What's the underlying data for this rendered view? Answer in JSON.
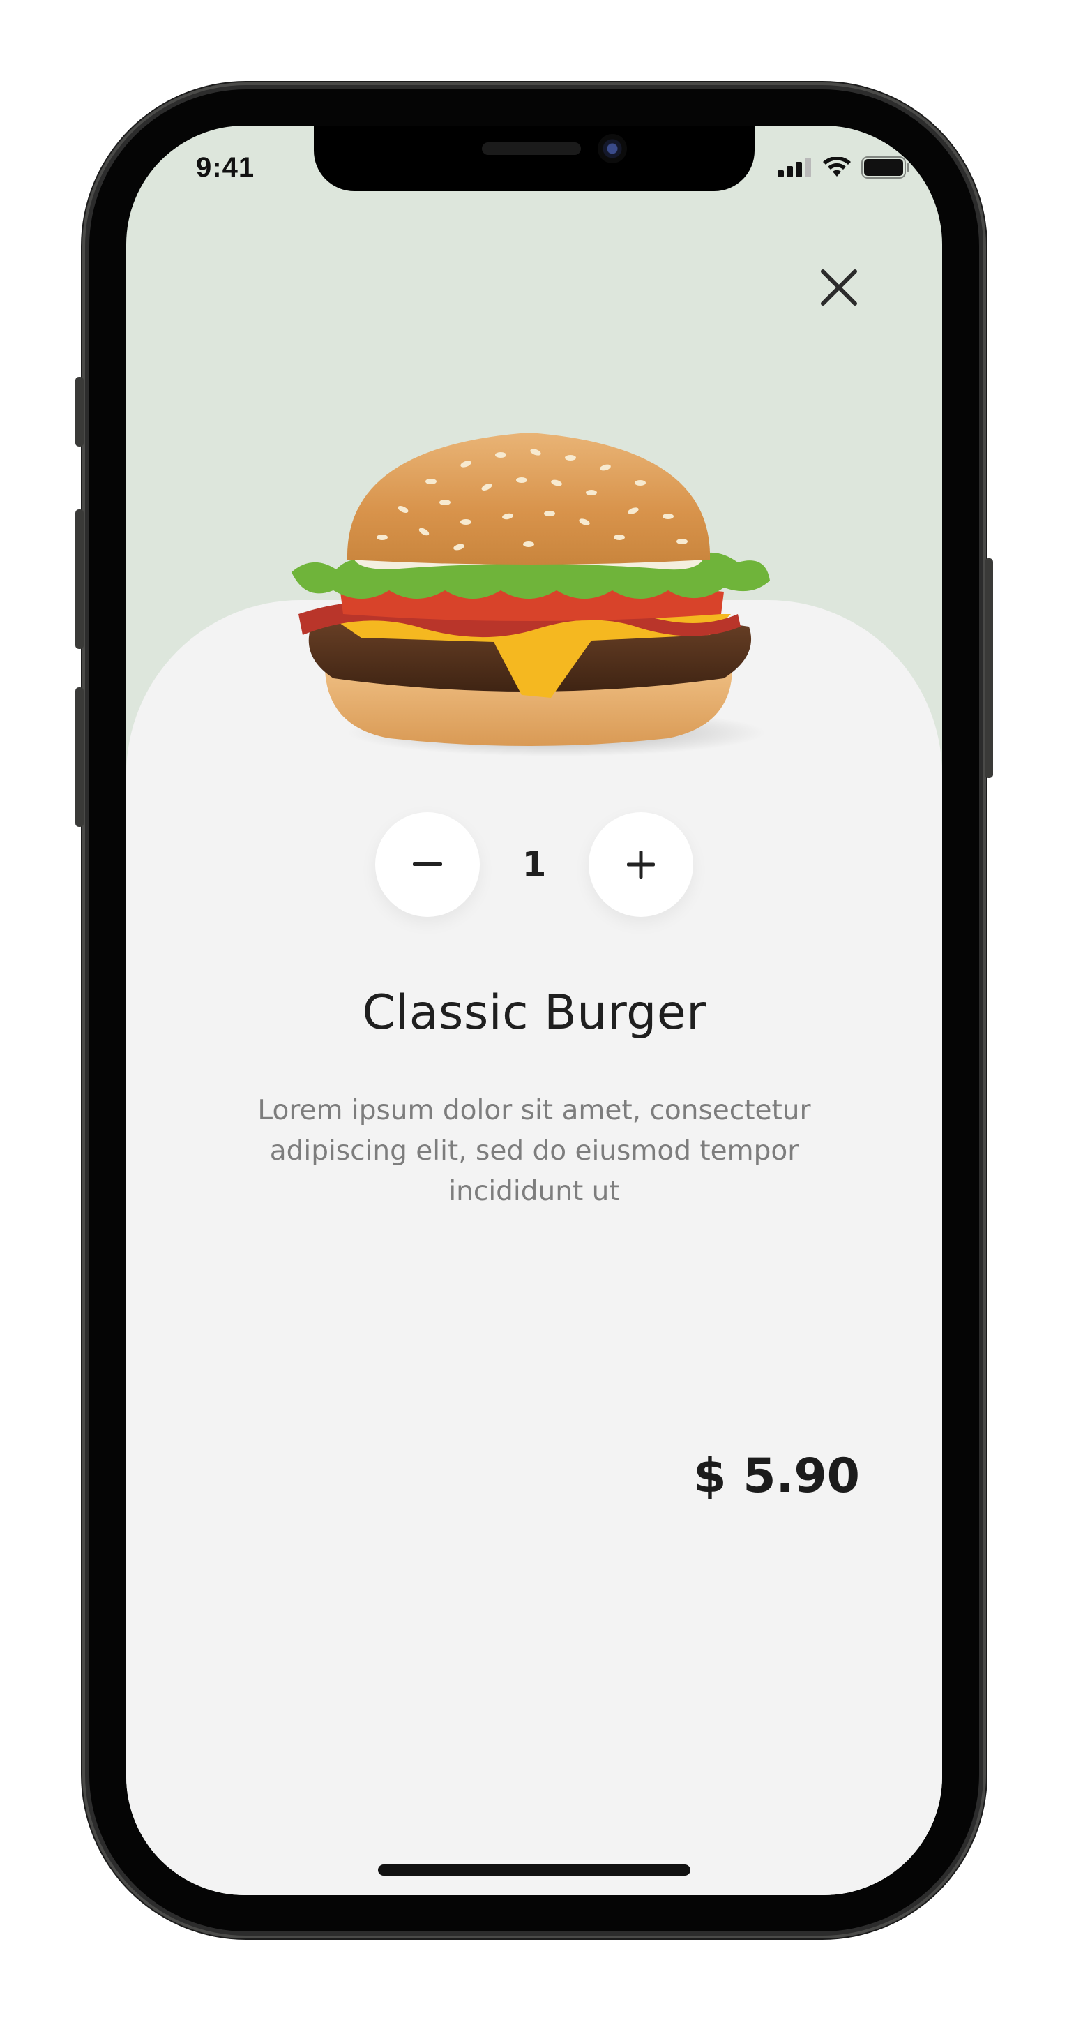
{
  "status_bar": {
    "time": "9:41",
    "icons": [
      "cellular-signal-icon",
      "wifi-icon",
      "battery-icon"
    ]
  },
  "actions": {
    "close_icon": "close-icon"
  },
  "product": {
    "image": "burger-image",
    "name": "Classic Burger",
    "description": "Lorem ipsum dolor sit amet, consectetur adipiscing elit, sed do eiusmod tempor incididunt ut",
    "price": "$ 5.90"
  },
  "quantity": {
    "value": "1",
    "decrement_icon": "minus-icon",
    "increment_icon": "plus-icon"
  },
  "colors": {
    "header_background": "#dde6dc",
    "card_background": "#f3f3f3",
    "text_primary": "#1f1f1f",
    "text_secondary": "#7d7d7d"
  }
}
